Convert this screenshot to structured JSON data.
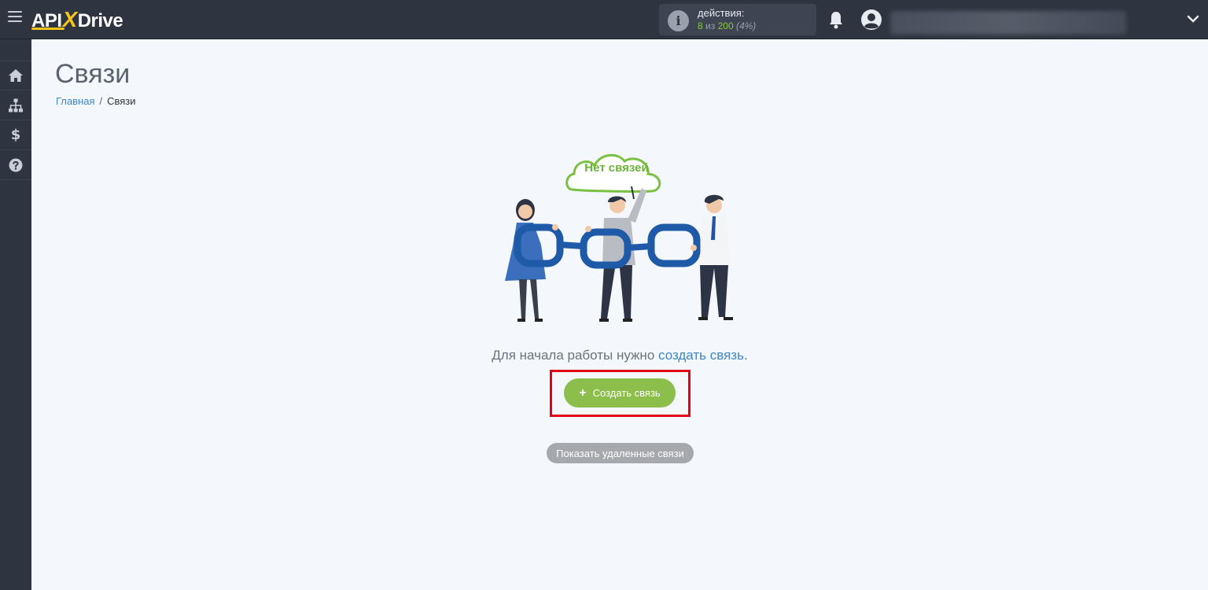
{
  "header": {
    "logo": {
      "part1": "API",
      "x": "X",
      "part2": "Drive"
    },
    "actions": {
      "label": "действия:",
      "used": "8",
      "of": "из",
      "total": "200",
      "percent": "(4%)"
    }
  },
  "page": {
    "title": "Связи"
  },
  "breadcrumb": {
    "home": "Главная",
    "separator": "/",
    "current": "Связи"
  },
  "empty_state": {
    "cloud_text": "Нет связей",
    "prompt_before": "Для начала работы нужно",
    "prompt_link": "создать связь",
    "prompt_after": "."
  },
  "buttons": {
    "create_plus": "+",
    "create_label": "Создать связь",
    "show_deleted": "Показать удаленные связи"
  },
  "sidebar": {
    "items": [
      {
        "icon": "home-icon"
      },
      {
        "icon": "sitemap-icon"
      },
      {
        "icon": "dollar-icon",
        "glyph": "$"
      },
      {
        "icon": "help-icon"
      }
    ]
  },
  "colors": {
    "topbar": "#2e3440",
    "accent_green": "#8cbe4b",
    "link_blue": "#3b86c6",
    "highlight_red": "#e3001b",
    "logo_yellow": "#f6c416"
  }
}
